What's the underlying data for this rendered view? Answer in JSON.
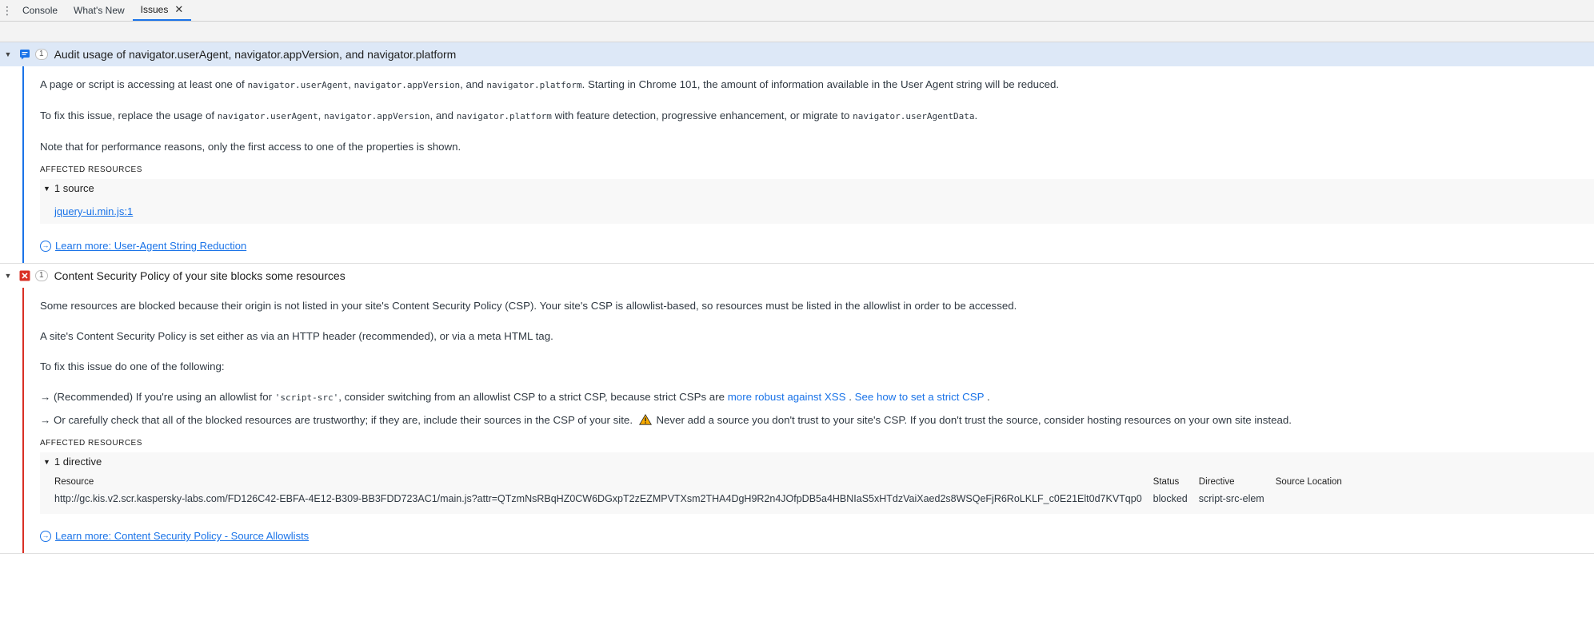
{
  "tabs": [
    {
      "label": "Console"
    },
    {
      "label": "What's New"
    },
    {
      "label": "Issues"
    }
  ],
  "issue1": {
    "count": "1",
    "title": "Audit usage of navigator.userAgent, navigator.appVersion, and navigator.platform",
    "p1_a": "A page or script is accessing at least one of ",
    "p1_c1": "navigator.userAgent",
    "p1_b": ", ",
    "p1_c2": "navigator.appVersion",
    "p1_c": ", and ",
    "p1_c3": "navigator.platform",
    "p1_d": ". Starting in Chrome 101, the amount of information available in the User Agent string will be reduced.",
    "p2_a": "To fix this issue, replace the usage of ",
    "p2_c1": "navigator.userAgent",
    "p2_b": ", ",
    "p2_c2": "navigator.appVersion",
    "p2_c": ", and ",
    "p2_c3": "navigator.platform",
    "p2_d": " with feature detection, progressive enhancement, or migrate to ",
    "p2_c4": "navigator.userAgentData",
    "p2_e": ".",
    "p3": "Note that for performance reasons, only the first access to one of the properties is shown.",
    "affected_title": "AFFECTED RESOURCES",
    "affected_toggle": "1 source",
    "source_link": "jquery-ui.min.js:1",
    "learn_more": "Learn more: User-Agent String Reduction"
  },
  "issue2": {
    "count": "1",
    "title": "Content Security Policy of your site blocks some resources",
    "p1": "Some resources are blocked because their origin is not listed in your site's Content Security Policy (CSP). Your site's CSP is allowlist-based, so resources must be listed in the allowlist in order to be accessed.",
    "p2": "A site's Content Security Policy is set either as via an HTTP header (recommended), or via a meta HTML tag.",
    "p3": "To fix this issue do one of the following:",
    "b1_a": "→ (Recommended) If you're using an allowlist for ",
    "b1_code": "'script-src'",
    "b1_b": ", consider switching from an allowlist CSP to a strict CSP, because strict CSPs are ",
    "b1_link1": "more robust against XSS",
    "b1_sep": " . ",
    "b1_link2": "See how to set a strict CSP",
    "b1_end": " .",
    "b2_a": "→ Or carefully check that all of the blocked resources are trustworthy; if they are, include their sources in the CSP of your site.",
    "b2_b": "Never add a source you don't trust to your site's CSP. If you don't trust the source, consider hosting resources on your own site instead.",
    "affected_title": "AFFECTED RESOURCES",
    "affected_toggle": "1 directive",
    "table": {
      "headers": {
        "resource": "Resource",
        "status": "Status",
        "directive": "Directive",
        "source_location": "Source Location"
      },
      "rows": [
        {
          "resource": "http://gc.kis.v2.scr.kaspersky-labs.com/FD126C42-EBFA-4E12-B309-BB3FDD723AC1/main.js?attr=QTzmNsRBqHZ0CW6DGxpT2zEZMPVTXsm2THA4DgH9R2n4JOfpDB5a4HBNIaS5xHTdzVaiXaed2s8WSQeFjR6RoLKLF_c0E21Elt0d7KVTqp0",
          "status": "blocked",
          "directive": "script-src-elem",
          "source_location": ""
        }
      ]
    },
    "learn_more": "Learn more: Content Security Policy - Source Allowlists"
  },
  "icons": {
    "issue1_category": "message-icon",
    "issue2_category": "error-x-icon"
  },
  "colors": {
    "accent": "#1a73e8",
    "error": "#d93025",
    "selected_row": "#dde8f7"
  }
}
